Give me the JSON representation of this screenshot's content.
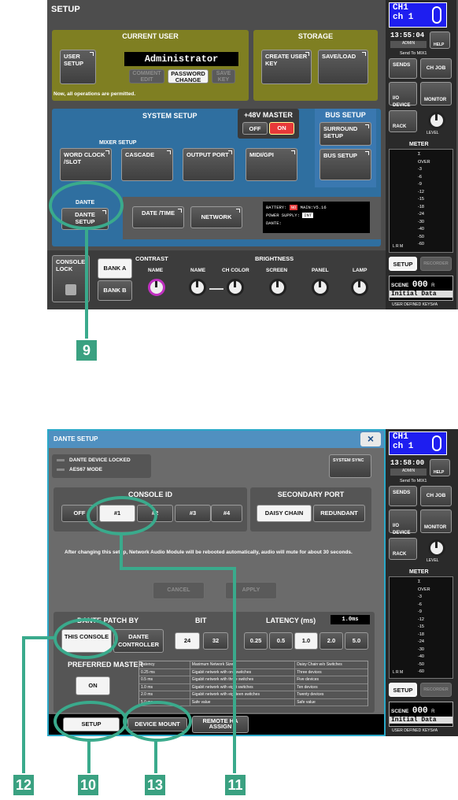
{
  "screen1": {
    "title": "SETUP",
    "current_user": {
      "header": "CURRENT USER",
      "user_setup": "USER SETUP",
      "user_name": "Administrator",
      "comment_edit": "COMMENT EDIT",
      "password_change": "PASSWORD CHANGE",
      "save_key": "SAVE KEY",
      "permission_text": "Now, all operations are permitted."
    },
    "storage": {
      "header": "STORAGE",
      "create_user_key": "CREATE USER KEY",
      "save_load": "SAVE/LOAD"
    },
    "system_setup": {
      "header": "SYSTEM SETUP",
      "master48v": "+48V MASTER",
      "off": "OFF",
      "on": "ON",
      "mixer_setup": "MIXER SETUP",
      "word_clock": "WORD CLOCK /SLOT",
      "cascade": "CASCADE",
      "output_port": "OUTPUT PORT",
      "midi_gpi": "MIDI/GPI",
      "dante": "DANTE",
      "dante_setup": "DANTE SETUP",
      "date_time": "DATE /TIME",
      "network": "NETWORK",
      "battery": "BATTERY:",
      "battery_status": "NO",
      "main_version": "MAIN:V5.16",
      "power_supply": "POWER SUPPLY:",
      "power_status": "INT",
      "dante_status": "DANTE:"
    },
    "bus_setup": {
      "header": "BUS SETUP",
      "surround_setup": "SURROUND SETUP",
      "bus_setup_btn": "BUS SETUP"
    },
    "bottom": {
      "console_lock": "CONSOLE LOCK",
      "bank_a": "BANK A",
      "bank_b": "BANK B",
      "contrast": "CONTRAST",
      "brightness": "BRIGHTNESS",
      "knobs": [
        "NAME",
        "NAME",
        "CH COLOR",
        "SCREEN",
        "PANEL",
        "LAMP"
      ]
    },
    "side": {
      "ch": "CH1",
      "ch_sub": "ch 1",
      "time": "13:55:04",
      "admin": "ADMIN",
      "help": "HELP",
      "send_to": "Send To MIX1",
      "sends": "SENDS",
      "ch_job": "CH JOB",
      "io_device": "I/O DEVICE",
      "monitor": "MONITOR",
      "rack": "RACK",
      "level": "LEVEL",
      "meter": "METER",
      "scale": [
        "Σ",
        "OVER",
        "-3",
        "-6",
        "-9",
        "-12",
        "-15",
        "-18",
        "-24",
        "-30",
        "-40",
        "-50",
        "-60"
      ],
      "lrm": "L R M",
      "setup": "SETUP",
      "recorder": "RECORDER",
      "scene": "SCENE",
      "scene_no": "000",
      "scene_r": "R",
      "scene_name": "Initial Data",
      "user_keys": "USER DEFINED KEYS#A"
    }
  },
  "screen2": {
    "title": "DANTE SETUP",
    "close": "×",
    "dante_device_locked": "DANTE DEVICE LOCKED",
    "aes67_mode": "AES67 MODE",
    "system_sync": "SYSTEM SYNC",
    "console_id": "CONSOLE ID",
    "console_id_options": [
      "OFF",
      "#1",
      "#2",
      "#3",
      "#4"
    ],
    "secondary_port": "SECONDARY PORT",
    "daisy_chain": "DAISY CHAIN",
    "redundant": "REDUNDANT",
    "message": "After changing this setup, Network Audio Module will be rebooted automatically, audio will mute for about 30 seconds.",
    "cancel": "CANCEL",
    "apply": "APPLY",
    "patch_by": "DANTE PATCH BY",
    "this_console": "THIS CONSOLE",
    "dante_controller": "DANTE CONTROLLER",
    "bit": "BIT",
    "bit_options": [
      "24",
      "32"
    ],
    "latency": "LATENCY (ms)",
    "latency_value": "1.0ms",
    "latency_options": [
      "0.25",
      "0.5",
      "1.0",
      "2.0",
      "5.0"
    ],
    "preferred_master": "PREFERRED MASTER",
    "on": "ON",
    "table": {
      "headers": [
        "Latency",
        "Maximum Network Size",
        "Daisy Chain w/o Switches"
      ],
      "rows": [
        [
          "0.25 ms",
          "Gigabit network with one switches",
          "Three devices"
        ],
        [
          "0.5 ms",
          "Gigabit network with three switches",
          "Five devices"
        ],
        [
          "1.0 ms",
          "Gigabit network with eight switches",
          "Ten devices"
        ],
        [
          "2.0 ms",
          "Gigabit network with eighteen switches",
          "Twenty devices"
        ],
        [
          "5.0 ms",
          "Safe value",
          "Safe value"
        ]
      ]
    },
    "tabs": [
      "SETUP",
      "DEVICE MOUNT",
      "REMOTE HA ASSIGN"
    ],
    "side": {
      "ch": "CH1",
      "ch_sub": "ch 1",
      "time": "13:58:00",
      "admin": "ADMIN",
      "help": "HELP",
      "send_to": "Send To MIX1",
      "sends": "SENDS",
      "ch_job": "CH JOB",
      "io_device": "I/O DEVICE",
      "monitor": "MONITOR",
      "rack": "RACK",
      "level": "LEVEL",
      "meter": "METER",
      "scale": [
        "Σ",
        "OVER",
        "-3",
        "-6",
        "-9",
        "-12",
        "-15",
        "-18",
        "-24",
        "-30",
        "-40",
        "-50",
        "-60"
      ],
      "lrm": "L R M",
      "setup": "SETUP",
      "recorder": "RECORDER",
      "scene": "SCENE",
      "scene_no": "000",
      "scene_r": "R",
      "scene_name": "Initial Data",
      "user_keys": "USER DEFINED KEYS#A"
    }
  },
  "callouts": [
    "9",
    "10",
    "11",
    "12",
    "13"
  ],
  "colors": {
    "accent": "#3aa181",
    "ring": "#3aaa8c",
    "olive": "#7a7a1e",
    "blue": "#2f6fa0",
    "on_red": "#e63939"
  }
}
